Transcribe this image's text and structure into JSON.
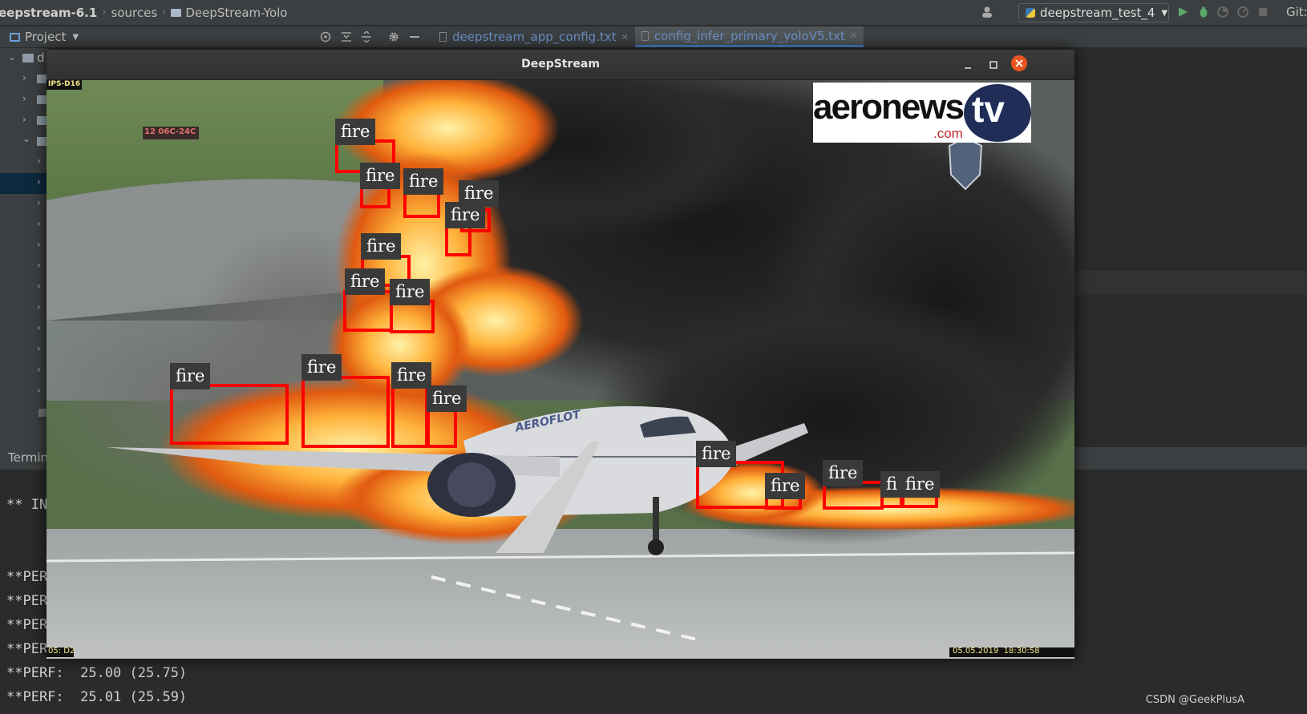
{
  "topbar": {
    "breadcrumb": [
      "eepstream-6.1",
      "sources",
      "DeepStream-Yolo"
    ],
    "run_config": "deepstream_test_4",
    "git_label": "Git:"
  },
  "project_panel": {
    "title": "Project",
    "root_initial": "d"
  },
  "editor_tabs": [
    {
      "label": "deepstream_app_config.txt",
      "active": false
    },
    {
      "label": "config_infer_primary_yoloV5.txt",
      "active": true
    }
  ],
  "terminal": {
    "tab_label": "Termin",
    "lines": [
      "** IN",
      "**PERF",
      "**PERF",
      "**PERF",
      "**PERF:  25.00 (25.75)",
      "**PERF:  25.01 (25.59)"
    ]
  },
  "deepstream_window": {
    "title": "DeepStream",
    "video": {
      "channel_tag": "IPS-D16",
      "runway_sign": "12 06C-24C",
      "logo": {
        "main": "aeronews",
        "suffix": "tv",
        "domain": ".com"
      },
      "osd_left": "05: D2",
      "osd_right": "05.05.2019  18:30:58",
      "airline_text": "AEROFLOT"
    },
    "detection_label": "fire",
    "detections": [
      {
        "label": "fire"
      },
      {
        "label": "fire"
      },
      {
        "label": "fire"
      },
      {
        "label": "fire"
      },
      {
        "label": "fire"
      },
      {
        "label": "fire"
      },
      {
        "label": "fire"
      },
      {
        "label": "fire"
      },
      {
        "label": "fire"
      },
      {
        "label": "fire"
      },
      {
        "label": "fire"
      },
      {
        "label": "fire"
      },
      {
        "label": "fire"
      },
      {
        "label": "fire"
      },
      {
        "label": "fire"
      },
      {
        "label": "fi"
      },
      {
        "label": "fire"
      }
    ]
  },
  "watermark": "CSDN @GeekPlusA"
}
